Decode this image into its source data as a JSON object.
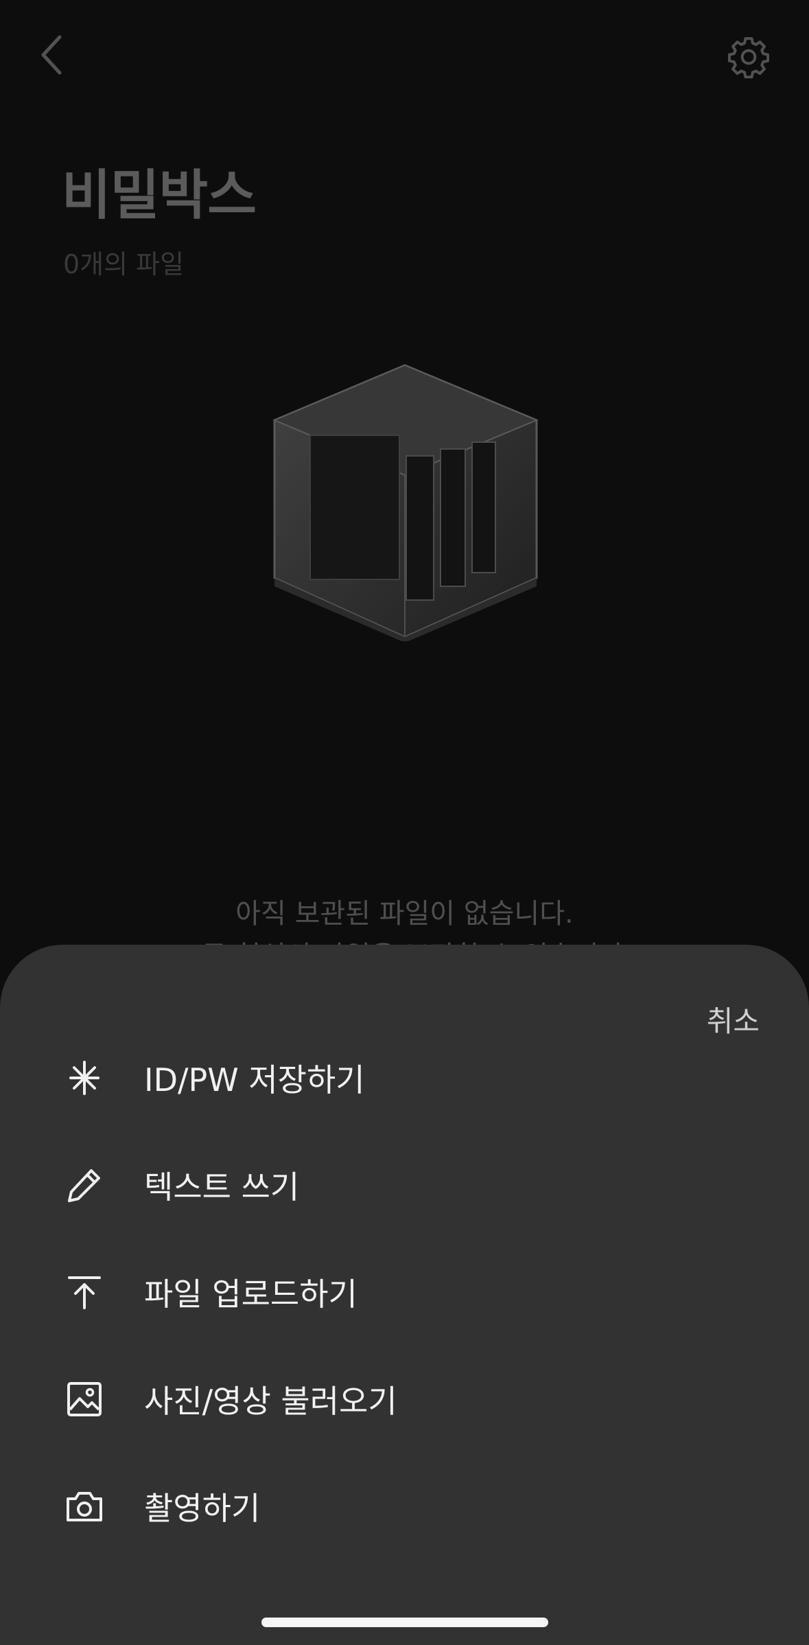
{
  "header": {
    "back_icon": "chevron-left-icon",
    "settings_icon": "gear-icon",
    "title": "비밀박스",
    "file_count": "0개의 파일"
  },
  "empty_state": {
    "line1": "아직 보관된 파일이 없습니다.",
    "line2": "모든 형식의 파일을 보관할 수 있습니다."
  },
  "sheet": {
    "cancel_label": "취소",
    "items": [
      {
        "label": "ID/PW 저장하기",
        "icon": "asterisk-icon"
      },
      {
        "label": "텍스트 쓰기",
        "icon": "pencil-icon"
      },
      {
        "label": "파일 업로드하기",
        "icon": "upload-icon"
      },
      {
        "label": "사진/영상 불러오기",
        "icon": "image-icon"
      },
      {
        "label": "촬영하기",
        "icon": "camera-icon"
      }
    ]
  },
  "colors": {
    "background": "#121212",
    "sheet": "#323232"
  }
}
